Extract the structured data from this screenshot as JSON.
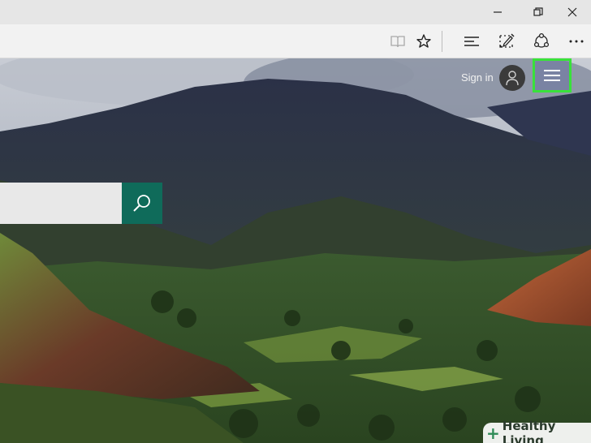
{
  "window": {
    "controls": [
      "minimize",
      "restore",
      "close"
    ]
  },
  "toolbar": {
    "icons": [
      "reading-view-icon",
      "favorites-star-icon",
      "hub-icon",
      "web-note-icon",
      "share-icon",
      "more-icon"
    ]
  },
  "header": {
    "signin_label": "Sign in"
  },
  "search": {
    "value": "",
    "placeholder": ""
  },
  "watermark": {
    "text": "Healthy Living",
    "symbol": "+"
  },
  "colors": {
    "highlight": "#39e23a",
    "search_button": "#0f6b5a"
  }
}
